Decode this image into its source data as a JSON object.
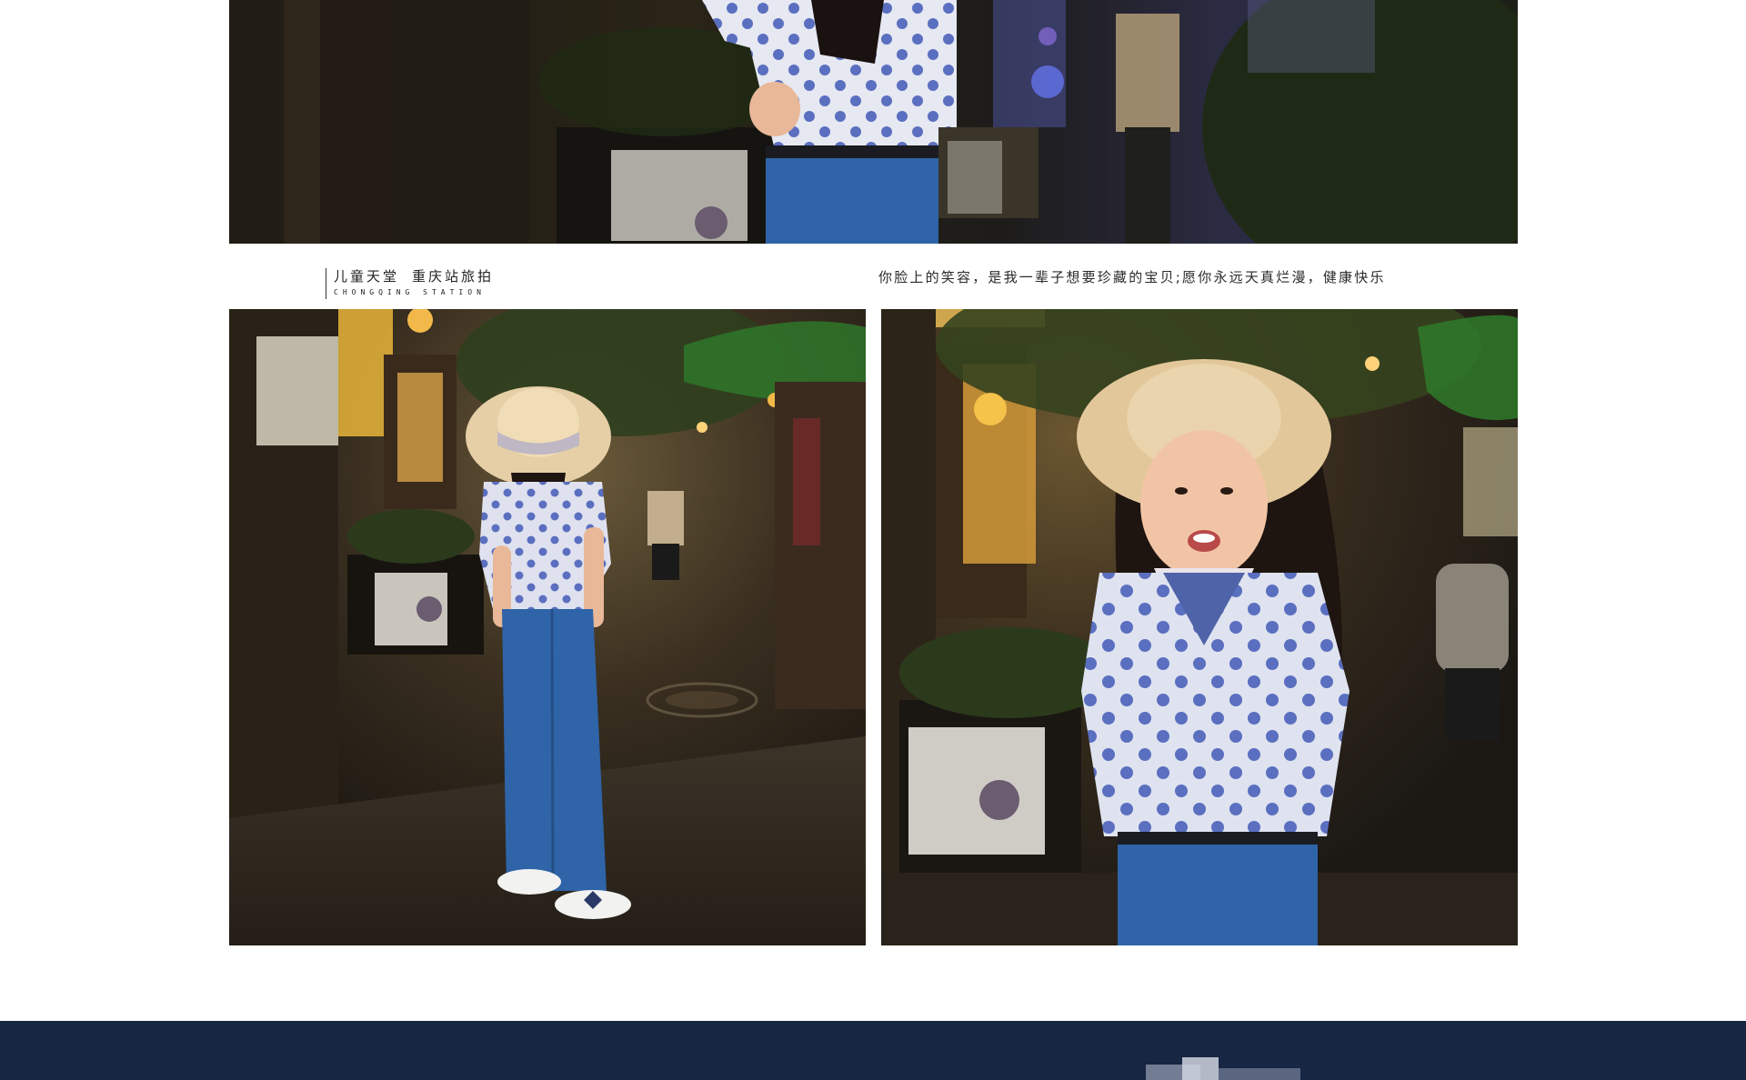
{
  "brand": {
    "title_part1": "儿童天堂",
    "title_part2": "重庆站旅拍",
    "subtitle": "CHONGQING STATION"
  },
  "caption": {
    "text": "你脸上的笑容，是我一辈子想要珍藏的宝贝;愿你永远天真烂漫，健康快乐"
  },
  "colors": {
    "caption_text": "#2a2a2a",
    "band": "#14213c",
    "shirt_dots": "#5b6fc0",
    "denim": "#2f64a8"
  }
}
